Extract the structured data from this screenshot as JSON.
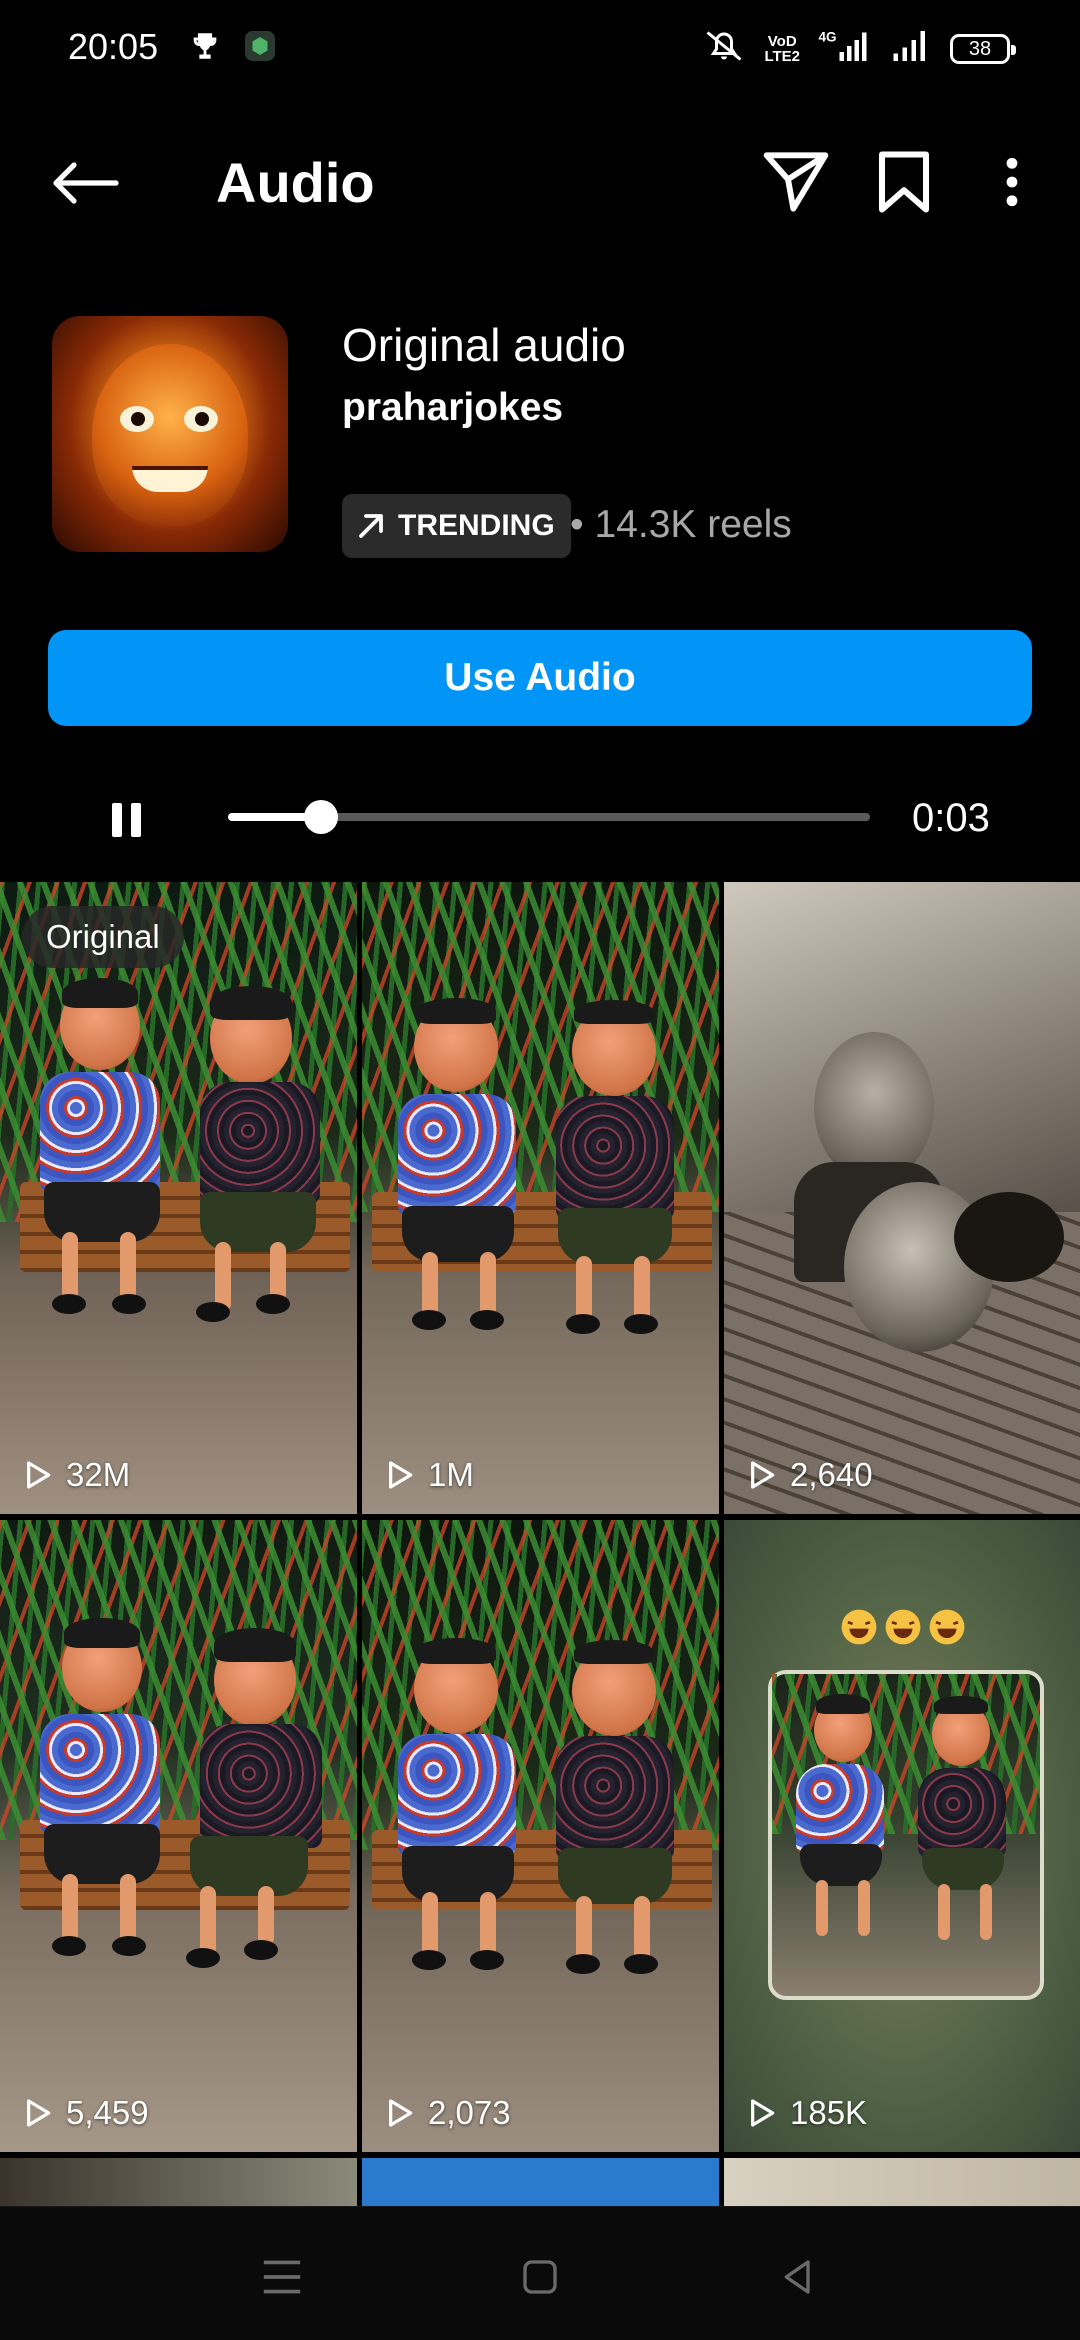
{
  "status_bar": {
    "time": "20:05",
    "network_label_1": "VoD",
    "network_label_2": "LTE2",
    "network_type": "4G",
    "battery": "38"
  },
  "header": {
    "title": "Audio",
    "back_icon": "arrow-left-icon",
    "share_icon": "paper-plane-icon",
    "save_icon": "bookmark-icon",
    "more_icon": "more-vertical-icon"
  },
  "audio": {
    "title": "Original audio",
    "artist": "praharjokes",
    "trending_label": "TRENDING",
    "reels_count": "• 14.3K reels"
  },
  "use_audio_button": "Use Audio",
  "player": {
    "elapsed": "0:03",
    "progress": 0.145,
    "state": "playing"
  },
  "grid": {
    "original_label": "Original",
    "tiles": [
      {
        "plays": "32M"
      },
      {
        "plays": "1M"
      },
      {
        "plays": "2,640"
      },
      {
        "plays": "5,459"
      },
      {
        "plays": "2,073"
      },
      {
        "plays": "185K"
      }
    ]
  },
  "colors": {
    "accent": "#0095f6",
    "badge_bg": "#2b2b2b",
    "muted_text": "#a8a8a8"
  }
}
